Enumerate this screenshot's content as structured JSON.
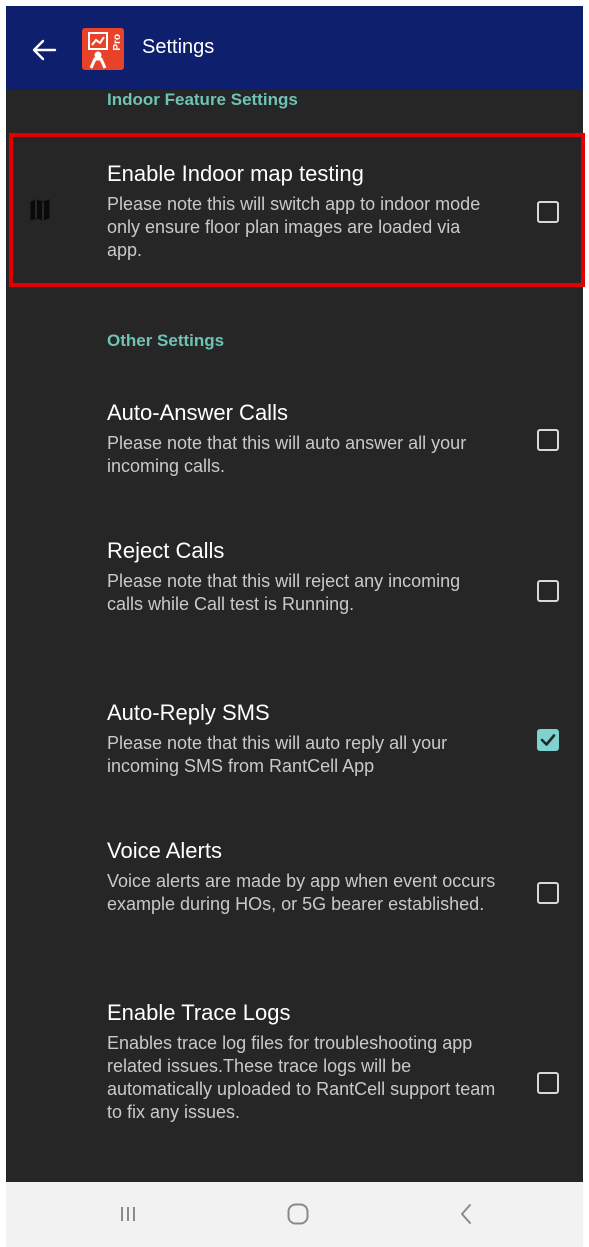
{
  "appbar": {
    "title": "Settings",
    "logo_badge": "Pro",
    "back_icon": "arrow-left-icon",
    "colors": {
      "background": "#0e1f6e",
      "logo": "#e8432a"
    }
  },
  "sections": {
    "indoor_header": "Indoor Feature Settings",
    "other_header": "Other Settings"
  },
  "prefs": {
    "indoor_map": {
      "title": "Enable Indoor map testing",
      "summary": "Please note this will switch app to indoor mode only ensure floor plan images are loaded via app.",
      "icon": "map-icon",
      "checked": false,
      "highlighted": true
    },
    "auto_answer": {
      "title": "Auto-Answer Calls",
      "summary": "Please note that this will auto answer all your incoming calls.",
      "checked": false
    },
    "reject_calls": {
      "title": "Reject Calls",
      "summary": "Please note that this will reject any incoming calls while Call test is Running.",
      "checked": false
    },
    "auto_reply_sms": {
      "title": "Auto-Reply SMS",
      "summary": "Please note that this will auto reply all your incoming SMS from RantCell App",
      "checked": true
    },
    "voice_alerts": {
      "title": "Voice Alerts",
      "summary": "Voice alerts are made by app when event occurs example during HOs, or 5G bearer established.",
      "checked": false
    },
    "trace_logs": {
      "title": "Enable Trace Logs",
      "summary": "Enables trace log files for troubleshooting app related issues.These trace logs will be automatically uploaded to RantCell support team to fix any issues.",
      "checked": false
    }
  },
  "colors": {
    "accent": "#7fd3cf",
    "section_header": "#6ec3b5",
    "highlight_border": "#e00000",
    "screen_background": "#262626"
  },
  "navbar": {
    "recents_icon": "recents-icon",
    "home_icon": "home-icon",
    "back_icon": "back-chevron-icon"
  }
}
